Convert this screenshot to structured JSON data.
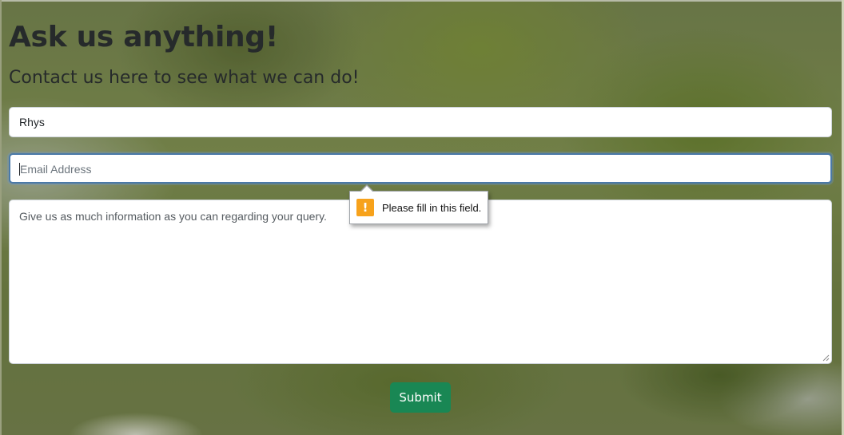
{
  "header": {
    "title": "Ask us anything!",
    "subtitle": "Contact us here to see what we can do!"
  },
  "form": {
    "name_value": "Rhys",
    "email_placeholder": "Email Address",
    "email_value": "",
    "message_placeholder": "Give us as much information as you can regarding your query.",
    "submit_label": "Submit"
  },
  "validation": {
    "message": "Please fill in this field.",
    "icon": "warning-icon"
  },
  "colors": {
    "submit_bg": "#198754",
    "focus_border": "#4a79a8",
    "warning": "#f7a21b"
  }
}
